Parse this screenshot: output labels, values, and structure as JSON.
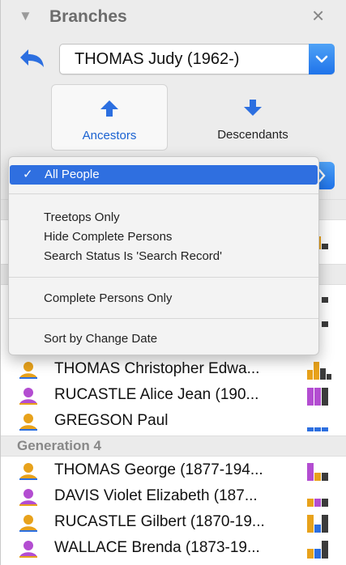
{
  "header": {
    "title": "Branches",
    "close": "×"
  },
  "person_select": {
    "value": "THOMAS Judy (1962-)"
  },
  "modes": {
    "ancestors": "Ancestors",
    "descendants": "Descendants"
  },
  "menu": {
    "check": "✓",
    "items": [
      "All People",
      "Treetops Only",
      "Hide Complete Persons",
      "Search Status Is 'Search Record'",
      "Complete Persons Only",
      "Sort by Change Date"
    ]
  },
  "list": {
    "rows_top": [
      {
        "name": "THOMAS Christopher Edwa...",
        "icon_color": "#e8a21b"
      },
      {
        "name": "RUCASTLE Alice Jean (190...",
        "icon_color": "#b34dd1"
      },
      {
        "name": "GREGSON Paul",
        "icon_color": "#e8a21b"
      }
    ],
    "generation_4": "Generation 4",
    "rows_gen4": [
      {
        "name": "THOMAS George (1877-194...",
        "icon_color": "#e8a21b"
      },
      {
        "name": "DAVIS Violet Elizabeth (187...",
        "icon_color": "#b34dd1"
      },
      {
        "name": "RUCASTLE Gilbert (1870-19...",
        "icon_color": "#e8a21b"
      },
      {
        "name": "WALLACE Brenda (1873-19...",
        "icon_color": "#b34dd1"
      }
    ]
  },
  "colors": {
    "accent": "#2f6fe0",
    "orange": "#e8a21b",
    "purple": "#b34dd1",
    "dark": "#3b3b3b"
  }
}
